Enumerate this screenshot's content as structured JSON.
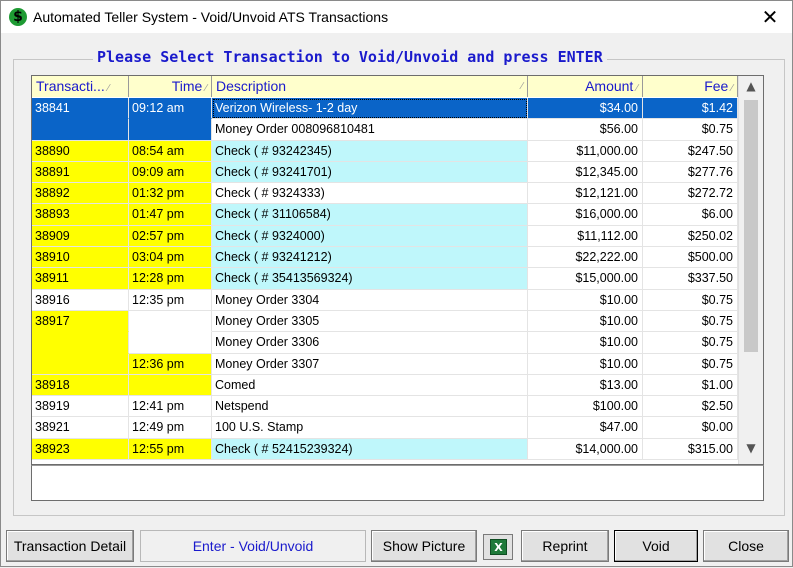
{
  "window": {
    "title": "Automated Teller System - Void/Unvoid ATS Transactions",
    "app_icon": "dollar-icon",
    "close_glyph": "✕"
  },
  "caption": "Please Select Transaction to Void/Unvoid and press ENTER",
  "columns": [
    "Transacti...",
    "Time",
    "Description",
    "Amount",
    "Fee"
  ],
  "colors": {
    "highlight": "#ffff00",
    "check_row": "#bff7fb",
    "selection": "#0a64c8",
    "caption": "#1a1acc"
  },
  "rows": [
    {
      "id": "38841",
      "time": "09:12 am",
      "desc": "Verizon Wireless- 1-2 day",
      "amount": "$34.00",
      "fee": "$1.42"
    },
    {
      "id": "",
      "time": "",
      "desc": "Money Order 008096810481",
      "amount": "$56.00",
      "fee": "$0.75"
    },
    {
      "id": "38890",
      "time": "08:54 am",
      "desc": "Check ( # 93242345)",
      "amount": "$11,000.00",
      "fee": "$247.50"
    },
    {
      "id": "38891",
      "time": "09:09 am",
      "desc": "Check ( # 93241701)",
      "amount": "$12,345.00",
      "fee": "$277.76"
    },
    {
      "id": "38892",
      "time": "01:32 pm",
      "desc": "Check ( # 9324333)",
      "amount": "$12,121.00",
      "fee": "$272.72"
    },
    {
      "id": "38893",
      "time": "01:47 pm",
      "desc": "Check ( # 31106584)",
      "amount": "$16,000.00",
      "fee": "$6.00"
    },
    {
      "id": "38909",
      "time": "02:57 pm",
      "desc": "Check ( # 9324000)",
      "amount": "$11,112.00",
      "fee": "$250.02"
    },
    {
      "id": "38910",
      "time": "03:04 pm",
      "desc": "Check ( # 93241212)",
      "amount": "$22,222.00",
      "fee": "$500.00"
    },
    {
      "id": "38911",
      "time": "12:28 pm",
      "desc": "Check ( # 35413569324)",
      "amount": "$15,000.00",
      "fee": "$337.50"
    },
    {
      "id": "38916",
      "time": "12:35 pm",
      "desc": "Money Order 3304",
      "amount": "$10.00",
      "fee": "$0.75"
    },
    {
      "id": "38917",
      "time": "",
      "desc": "Money Order 3305",
      "amount": "$10.00",
      "fee": "$0.75"
    },
    {
      "id": "",
      "time": "",
      "desc": "Money Order 3306",
      "amount": "$10.00",
      "fee": "$0.75"
    },
    {
      "id": "",
      "time": "12:36 pm",
      "desc": "Money Order 3307",
      "amount": "$10.00",
      "fee": "$0.75"
    },
    {
      "id": "38918",
      "time": "",
      "desc": "Comed",
      "amount": "$13.00",
      "fee": "$1.00"
    },
    {
      "id": "38919",
      "time": "12:41 pm",
      "desc": "Netspend",
      "amount": "$100.00",
      "fee": "$2.50"
    },
    {
      "id": "38921",
      "time": "12:49 pm",
      "desc": "100 U.S. Stamp",
      "amount": "$47.00",
      "fee": "$0.00"
    },
    {
      "id": "38923",
      "time": "12:55 pm",
      "desc": "Check ( # 52415239324)",
      "amount": "$14,000.00",
      "fee": "$315.00"
    }
  ],
  "buttons": {
    "transaction_detail": "Transaction Detail",
    "status": "Enter - Void/Unvoid",
    "show_picture": "Show Picture",
    "excel_icon": "excel-icon",
    "reprint": "Reprint",
    "void": "Void",
    "close": "Close"
  }
}
